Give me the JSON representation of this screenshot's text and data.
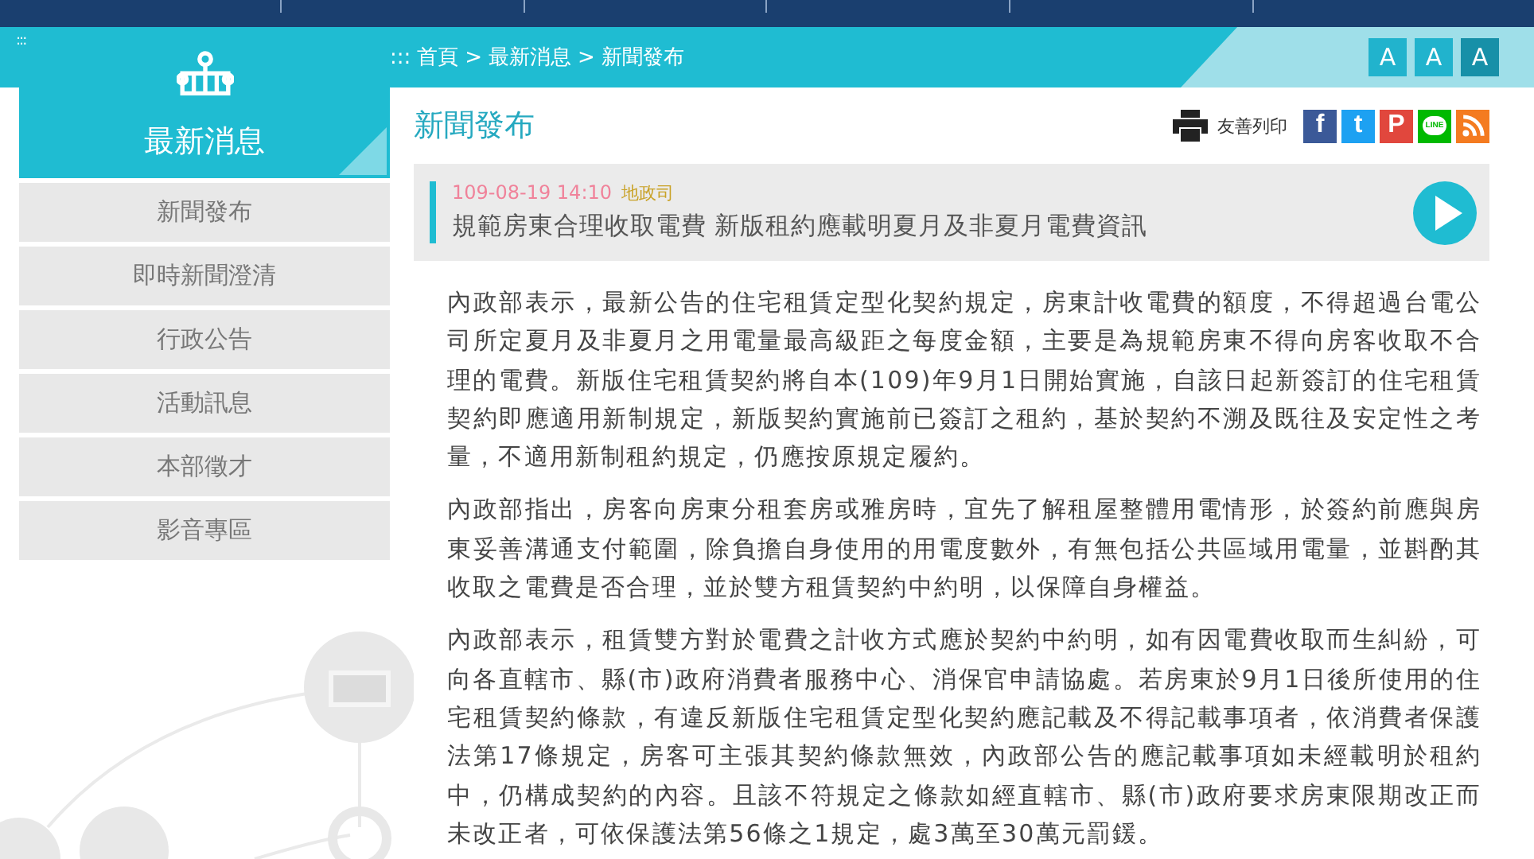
{
  "header": {
    "menu_glyph": ":::",
    "breadcrumb": [
      ":::",
      "首頁",
      ">",
      "最新消息",
      ">",
      "新聞發布"
    ],
    "font_sizes": [
      {
        "label": "A",
        "selected": false
      },
      {
        "label": "A",
        "selected": false
      },
      {
        "label": "A",
        "selected": true
      }
    ]
  },
  "sidebar": {
    "title": "最新消息",
    "items": [
      {
        "label": "新聞發布"
      },
      {
        "label": "即時新聞澄清"
      },
      {
        "label": "行政公告"
      },
      {
        "label": "活動訊息"
      },
      {
        "label": "本部徵才"
      },
      {
        "label": "影音專區"
      }
    ]
  },
  "main": {
    "title": "新聞發布",
    "print_label": "友善列印",
    "share": [
      {
        "kind": "facebook",
        "glyph": "f",
        "color": "#3b5998"
      },
      {
        "kind": "twitter",
        "glyph": "t",
        "color": "#1da1f2"
      },
      {
        "kind": "plurk",
        "glyph": "P",
        "color": "#e1473d"
      },
      {
        "kind": "line",
        "glyph": "LINE",
        "color": "#00b900"
      },
      {
        "kind": "rss",
        "color": "#f47b20"
      }
    ],
    "news": {
      "date": "109-08-19 14:10",
      "department": "地政司",
      "headline": "規範房東合理收取電費 新版租約應載明夏月及非夏月電費資訊"
    },
    "paragraphs": [
      "內政部表示，最新公告的住宅租賃定型化契約規定，房東計收電費的額度，不得超過台電公司所定夏月及非夏月之用電量最高級距之每度金額，主要是為規範房東不得向房客收取不合理的電費。新版住宅租賃契約將自本(109)年9月1日開始實施，自該日起新簽訂的住宅租賃契約即應適用新制規定，新版契約實施前已簽訂之租約，基於契約不溯及既往及安定性之考量，不適用新制租約規定，仍應按原規定履約。",
      "內政部指出，房客向房東分租套房或雅房時，宜先了解租屋整體用電情形，於簽約前應與房東妥善溝通支付範圍，除負擔自身使用的用電度數外，有無包括公共區域用電量，並斟酌其收取之電費是否合理，並於雙方租賃契約中約明，以保障自身權益。",
      "內政部表示，租賃雙方對於電費之計收方式應於契約中約明，如有因電費收取而生糾紛，可向各直轄市、縣(市)政府消費者服務中心、消保官申請協處。若房東於9月1日後所使用的住宅租賃契約條款，有違反新版住宅租賃定型化契約應記載及不得記載事項者，依消費者保護法第17條規定，房客可主張其契約條款無效，內政部公告的應記載事項如未經載明於租約中，仍構成契約的內容。且該不符規定之條款如經直轄市、縣(市)政府要求房東限期改正而未改正者，可依保護法第56條之1規定，處3萬至30萬元罰鍰。"
    ]
  }
}
